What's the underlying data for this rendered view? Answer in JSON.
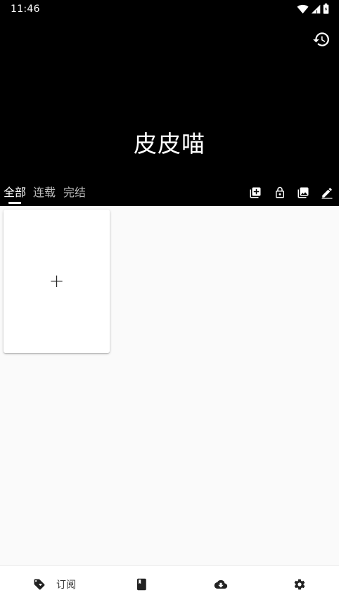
{
  "status_bar": {
    "time": "11:46",
    "icons": [
      "wifi-icon",
      "cell-signal-icon",
      "battery-icon"
    ]
  },
  "header": {
    "title": "皮皮喵",
    "history_icon": "history-icon"
  },
  "tabs": [
    {
      "label": "全部",
      "active": true
    },
    {
      "label": "连载",
      "active": false
    },
    {
      "label": "完结",
      "active": false
    }
  ],
  "toolbar": {
    "icons": [
      "library-add-icon",
      "lock-icon",
      "photo-library-icon",
      "edit-icon"
    ]
  },
  "grid": {
    "add_card_symbol": "+"
  },
  "bottom_nav": {
    "items": [
      {
        "icon": "tag-icon",
        "label": "订阅",
        "active": true
      },
      {
        "icon": "book-icon",
        "label": ""
      },
      {
        "icon": "cloud-download-icon",
        "label": ""
      },
      {
        "icon": "settings-icon",
        "label": ""
      }
    ]
  },
  "colors": {
    "header_bg": "#000000",
    "content_bg": "#fafafa",
    "active_text": "#ffffff",
    "inactive_tab_text": "#bdbdbd"
  }
}
